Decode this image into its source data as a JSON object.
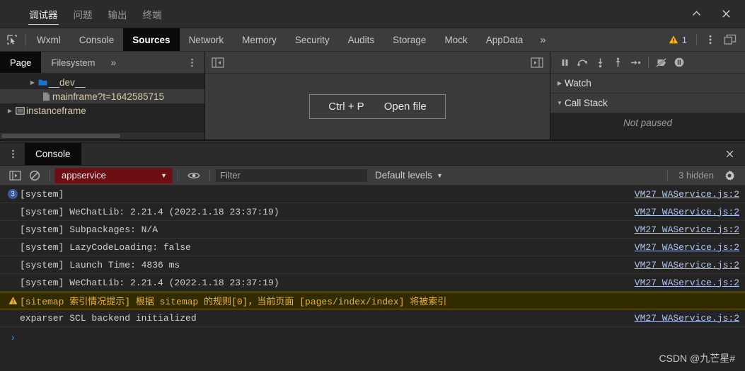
{
  "ide": {
    "tabs": [
      {
        "label": "调试器",
        "active": true
      },
      {
        "label": "问题",
        "active": false
      },
      {
        "label": "输出",
        "active": false
      },
      {
        "label": "终端",
        "active": false
      }
    ],
    "window_controls": [
      {
        "name": "collapse-chevron",
        "glyph": "^"
      },
      {
        "name": "close",
        "glyph": "×"
      }
    ]
  },
  "devtools": {
    "inspect_icon": "inspect-element-icon",
    "tabs": [
      {
        "label": "Wxml",
        "active": false
      },
      {
        "label": "Console",
        "active": false
      },
      {
        "label": "Sources",
        "active": true
      },
      {
        "label": "Network",
        "active": false
      },
      {
        "label": "Memory",
        "active": false
      },
      {
        "label": "Security",
        "active": false
      },
      {
        "label": "Audits",
        "active": false
      },
      {
        "label": "Storage",
        "active": false
      },
      {
        "label": "Mock",
        "active": false
      },
      {
        "label": "AppData",
        "active": false
      }
    ],
    "more_tabs_glyph": "»",
    "warning_count": "1",
    "warning_icon": "warning-triangle-icon",
    "kebab_icon": "more-options-icon",
    "dock_icon": "dock-side-icon"
  },
  "navigator": {
    "tabs": [
      {
        "label": "Page",
        "active": true
      },
      {
        "label": "Filesystem",
        "active": false
      }
    ],
    "more_glyph": "»",
    "kebab_icon": "navigator-more-options-icon",
    "tree": [
      {
        "label": "__dev__",
        "icon": "folder-icon",
        "indent": 2,
        "arrow": "collapsed",
        "selected": false,
        "color": "tan"
      },
      {
        "label": "mainframe?t=1642585715",
        "icon": "file-icon",
        "indent": 3,
        "arrow": "none",
        "selected": true,
        "color": "tan"
      },
      {
        "label": "instanceframe",
        "icon": "frame-icon",
        "indent": 0,
        "arrow": "collapsed",
        "selected": false,
        "color": "tan"
      }
    ]
  },
  "editor": {
    "left_panel_toggle_icon": "show-navigator-icon",
    "right_panel_toggle_icon": "show-debugger-icon",
    "open_file_shortcut": "Ctrl + P",
    "open_file_label": "Open file",
    "accent_border_color": "#5b87d6"
  },
  "debugger": {
    "toolbar": [
      {
        "name": "pause-resume-button",
        "icon": "pause-icon"
      },
      {
        "name": "step-over-button",
        "icon": "step-over-icon"
      },
      {
        "name": "step-into-button",
        "icon": "step-into-icon"
      },
      {
        "name": "step-out-button",
        "icon": "step-out-icon"
      },
      {
        "name": "step-button",
        "icon": "step-icon"
      },
      {
        "name": "deactivate-breakpoints-button",
        "icon": "deactivate-breakpoints-icon"
      },
      {
        "name": "pause-on-exceptions-button",
        "icon": "pause-on-exceptions-icon"
      }
    ],
    "sections": [
      {
        "label": "Watch",
        "expanded": false
      },
      {
        "label": "Call Stack",
        "expanded": true
      }
    ],
    "call_stack_empty": "Not paused"
  },
  "drawer": {
    "tab_label": "Console",
    "kebab_icon": "drawer-more-options-icon",
    "close_icon": "close-drawer-icon"
  },
  "console": {
    "sidebar_toggle_icon": "console-sidebar-icon",
    "clear_icon": "clear-console-icon",
    "context": "appservice",
    "context_caret": "▼",
    "context_bg": "#6b0f14",
    "eye_icon": "live-expression-icon",
    "filter_placeholder": "Filter",
    "filter_value": "",
    "levels_label": "Default levels",
    "levels_caret": "▼",
    "hidden_label": "3 hidden",
    "settings_icon": "console-settings-icon",
    "prompt_glyph": "›",
    "messages": [
      {
        "text": "[system]",
        "source": "VM27 WAService.js:2",
        "level": "info",
        "badge": "3"
      },
      {
        "text": "[system] WeChatLib: 2.21.4 (2022.1.18 23:37:19)",
        "source": "VM27 WAService.js:2",
        "level": "info",
        "badge": ""
      },
      {
        "text": "[system] Subpackages: N/A",
        "source": "VM27 WAService.js:2",
        "level": "info",
        "badge": ""
      },
      {
        "text": "[system] LazyCodeLoading: false",
        "source": "VM27 WAService.js:2",
        "level": "info",
        "badge": ""
      },
      {
        "text": "[system] Launch Time: 4836 ms",
        "source": "VM27 WAService.js:2",
        "level": "info",
        "badge": ""
      },
      {
        "text": "[system] WeChatLib: 2.21.4 (2022.1.18 23:37:19)",
        "source": "VM27 WAService.js:2",
        "level": "info",
        "badge": ""
      },
      {
        "text": "[sitemap 索引情况提示] 根据 sitemap 的规则[0]，当前页面 [pages/index/index] 将被索引",
        "source": "",
        "level": "warning",
        "badge": ""
      },
      {
        "text": "exparser SCL backend initialized",
        "source": "VM27 WAService.js:2",
        "level": "info",
        "badge": ""
      }
    ]
  },
  "watermark": "CSDN @九芒星#"
}
